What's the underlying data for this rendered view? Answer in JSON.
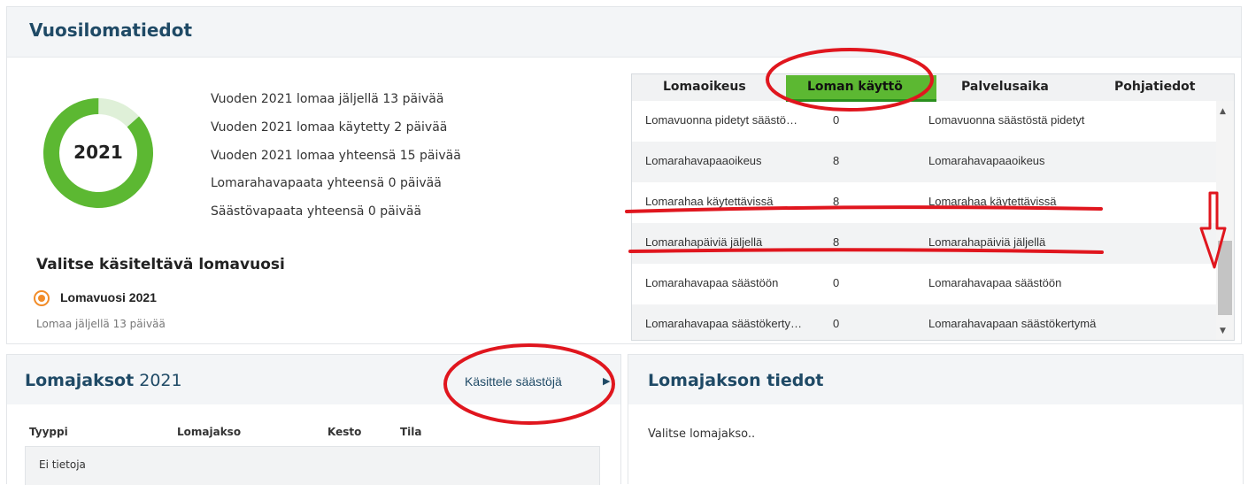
{
  "top": {
    "title": "Vuosilomatiedot",
    "donut": {
      "year": "2021",
      "used_fraction": 0.1333,
      "color_main": "#5cb832",
      "color_rest": "#dff0d8"
    },
    "stats": [
      "Vuoden 2021 lomaa jäljellä 13 päivää",
      "Vuoden 2021 lomaa käytetty 2 päivää",
      "Vuoden 2021 lomaa yhteensä 15 päivää",
      "Lomarahavapaata yhteensä 0 päivää",
      "Säästövapaata yhteensä 0 päivää"
    ],
    "select_title": "Valitse käsiteltävä lomavuosi",
    "radio_label": "Lomavuosi 2021",
    "radio_sub": "Lomaa jäljellä 13 päivää"
  },
  "tabs": {
    "items": [
      "Lomaoikeus",
      "Loman käyttö",
      "Palvelusaika",
      "Pohjatiedot"
    ],
    "active": "Loman käyttö",
    "active_color": "#5cb832"
  },
  "rows": [
    {
      "name": "Lomavuonna pidetyt säästö…",
      "value": "0",
      "desc": "Lomavuonna säästöstä pidetyt"
    },
    {
      "name": "Lomarahavapaaoikeus",
      "value": "8",
      "desc": "Lomarahavapaaoikeus"
    },
    {
      "name": "Lomarahaa käytettävissä",
      "value": "8",
      "desc": "Lomarahaa käytettävissä"
    },
    {
      "name": "Lomarahapäiviä jäljellä",
      "value": "8",
      "desc": "Lomarahapäiviä jäljellä"
    },
    {
      "name": "Lomarahavapaa säästöön",
      "value": "0",
      "desc": "Lomarahavapaa säästöön"
    },
    {
      "name": "Lomarahavapaa säästökerty…",
      "value": "0",
      "desc": "Lomarahavapaan säästökertymä"
    }
  ],
  "bottom_left": {
    "title_bold": "Lomajaksot",
    "title_year": "2021",
    "link": "Käsittele säästöjä",
    "columns": [
      "Tyyppi",
      "Lomajakso",
      "Kesto",
      "Tila"
    ],
    "empty": "Ei tietoja"
  },
  "bottom_right": {
    "title": "Lomajakson tiedot",
    "text": "Valitse lomajakso.."
  },
  "annotation_color": "#e0161e"
}
